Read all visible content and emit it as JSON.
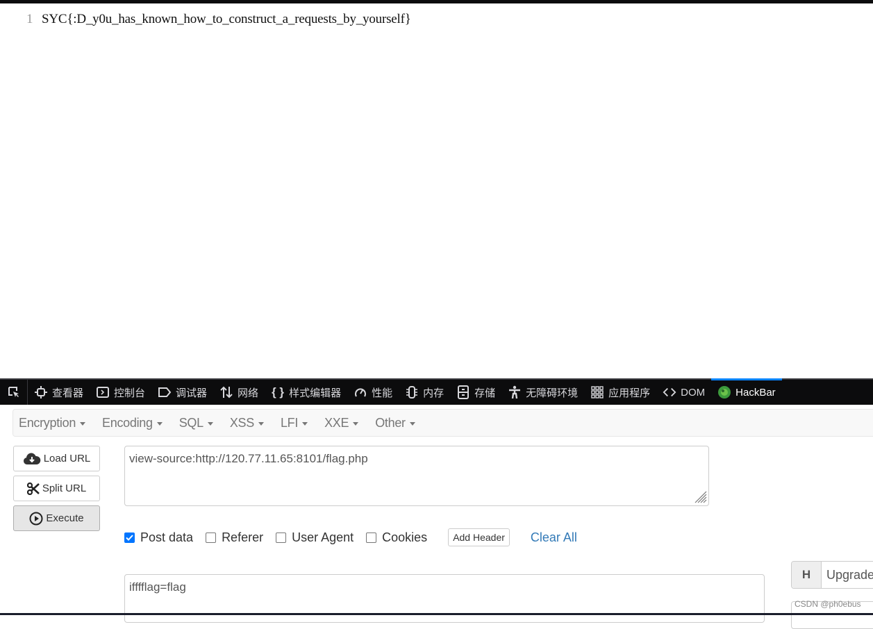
{
  "source_view": {
    "line_number": "1",
    "content": "SYC{:D_y0u_has_known_how_to_construct_a_requests_by_yourself}"
  },
  "devtools": {
    "tabs": [
      {
        "icon": "inspector-icon",
        "label": "查看器"
      },
      {
        "icon": "console-icon",
        "label": "控制台"
      },
      {
        "icon": "debugger-icon",
        "label": "调试器"
      },
      {
        "icon": "network-icon",
        "label": "网络"
      },
      {
        "icon": "style-editor-icon",
        "label": "样式编辑器"
      },
      {
        "icon": "performance-icon",
        "label": "性能"
      },
      {
        "icon": "memory-icon",
        "label": "内存"
      },
      {
        "icon": "storage-icon",
        "label": "存储"
      },
      {
        "icon": "accessibility-icon",
        "label": "无障碍环境"
      },
      {
        "icon": "application-icon",
        "label": "应用程序"
      },
      {
        "icon": "dom-icon",
        "label": "DOM"
      },
      {
        "icon": "hackbar-icon",
        "label": "HackBar"
      }
    ],
    "active_tab": "HackBar"
  },
  "hackbar": {
    "menu": [
      "Encryption",
      "Encoding",
      "SQL",
      "XSS",
      "LFI",
      "XXE",
      "Other"
    ],
    "buttons": {
      "load_url": "Load URL",
      "split_url": "Split URL",
      "execute": "Execute"
    },
    "url_value": "view-source:http://120.77.11.65:8101/flag.php",
    "options": {
      "post_data": {
        "label": "Post data",
        "checked": true
      },
      "referer": {
        "label": "Referer",
        "checked": false
      },
      "user_agent": {
        "label": "User Agent",
        "checked": false
      },
      "cookies": {
        "label": "Cookies",
        "checked": false
      }
    },
    "add_header_label": "Add Header",
    "clear_all_label": "Clear All",
    "post_body": "ifffflag=flag",
    "header_row": {
      "key": "H",
      "value": "Upgrade"
    },
    "accent_color": "#337ab7",
    "checkbox_color": "#0075ff"
  },
  "watermark": "CSDN @ph0ebus"
}
